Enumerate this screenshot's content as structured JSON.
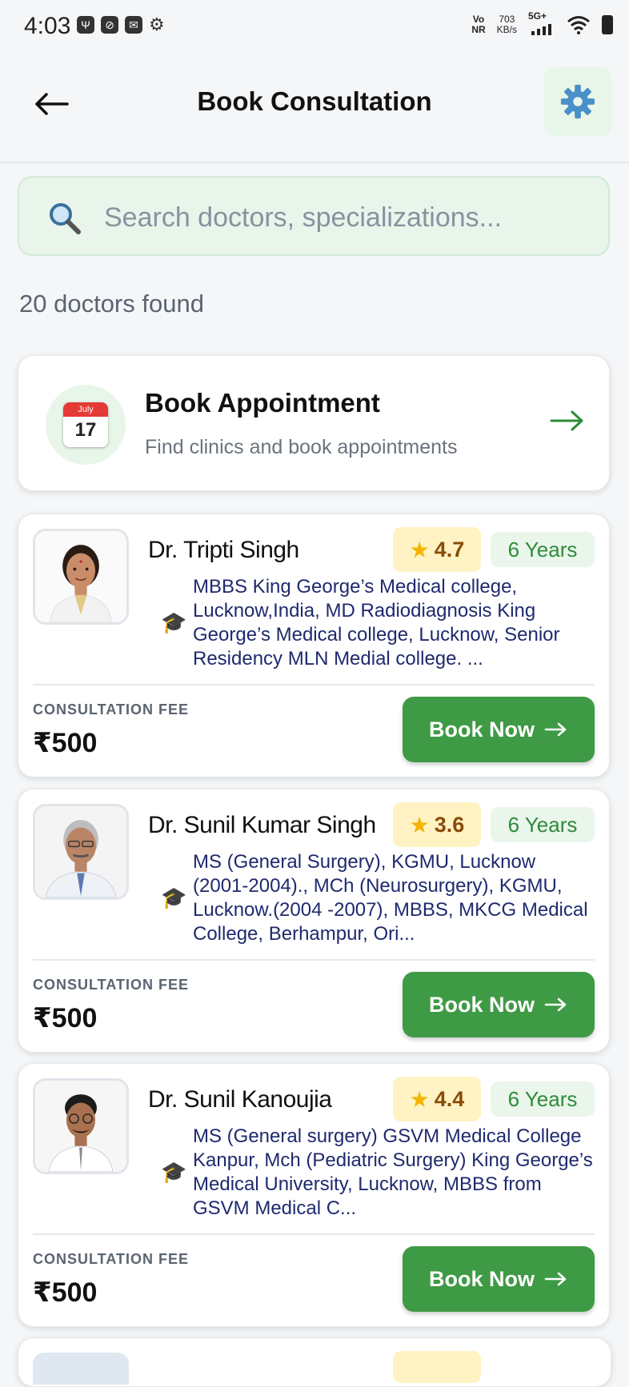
{
  "status_bar": {
    "time": "4:03",
    "network_top": "Vo",
    "network_bottom": "NR",
    "speed_value": "703",
    "speed_unit": "KB/s",
    "signal_type": "5G+"
  },
  "header": {
    "title": "Book Consultation"
  },
  "search": {
    "placeholder": "Search doctors, specializations..."
  },
  "results_count": "20 doctors found",
  "appointment_card": {
    "title": "Book Appointment",
    "subtitle": "Find clinics and book appointments",
    "calendar_month": "July",
    "calendar_day": "17"
  },
  "doctors": [
    {
      "name": "Dr. Tripti Singh",
      "rating": "4.7",
      "experience": "6 Years",
      "qualification": "MBBS  King George’s Medical college, Lucknow,India, MD  Radiodiagnosis  King George’s  Medical college, Lucknow, Senior Residency MLN Medial college. ...",
      "fee_label": "CONSULTATION FEE",
      "fee": "₹500",
      "book_label": "Book Now"
    },
    {
      "name": "Dr. Sunil Kumar Singh",
      "rating": "3.6",
      "experience": "6 Years",
      "qualification": "MS (General Surgery), KGMU, Lucknow (2001-2004)., MCh (Neurosurgery), KGMU, Lucknow.(2004 -2007), MBBS, MKCG Medical College, Berhampur, Ori...",
      "fee_label": "CONSULTATION FEE",
      "fee": "₹500",
      "book_label": "Book Now"
    },
    {
      "name": "Dr. Sunil Kanoujia",
      "rating": "4.4",
      "experience": "6 Years",
      "qualification": "MS (General surgery) GSVM Medical College Kanpur, Mch (Pediatric Surgery) King George’s Medical University, Lucknow, MBBS from GSVM Medical C...",
      "fee_label": "CONSULTATION FEE",
      "fee": "₹500",
      "book_label": "Book Now"
    }
  ],
  "colors": {
    "accent_green": "#3f9a45",
    "rating_bg": "#fff3c4",
    "experience_bg": "#eaf5eb",
    "qualification_text": "#1f2a6e"
  }
}
